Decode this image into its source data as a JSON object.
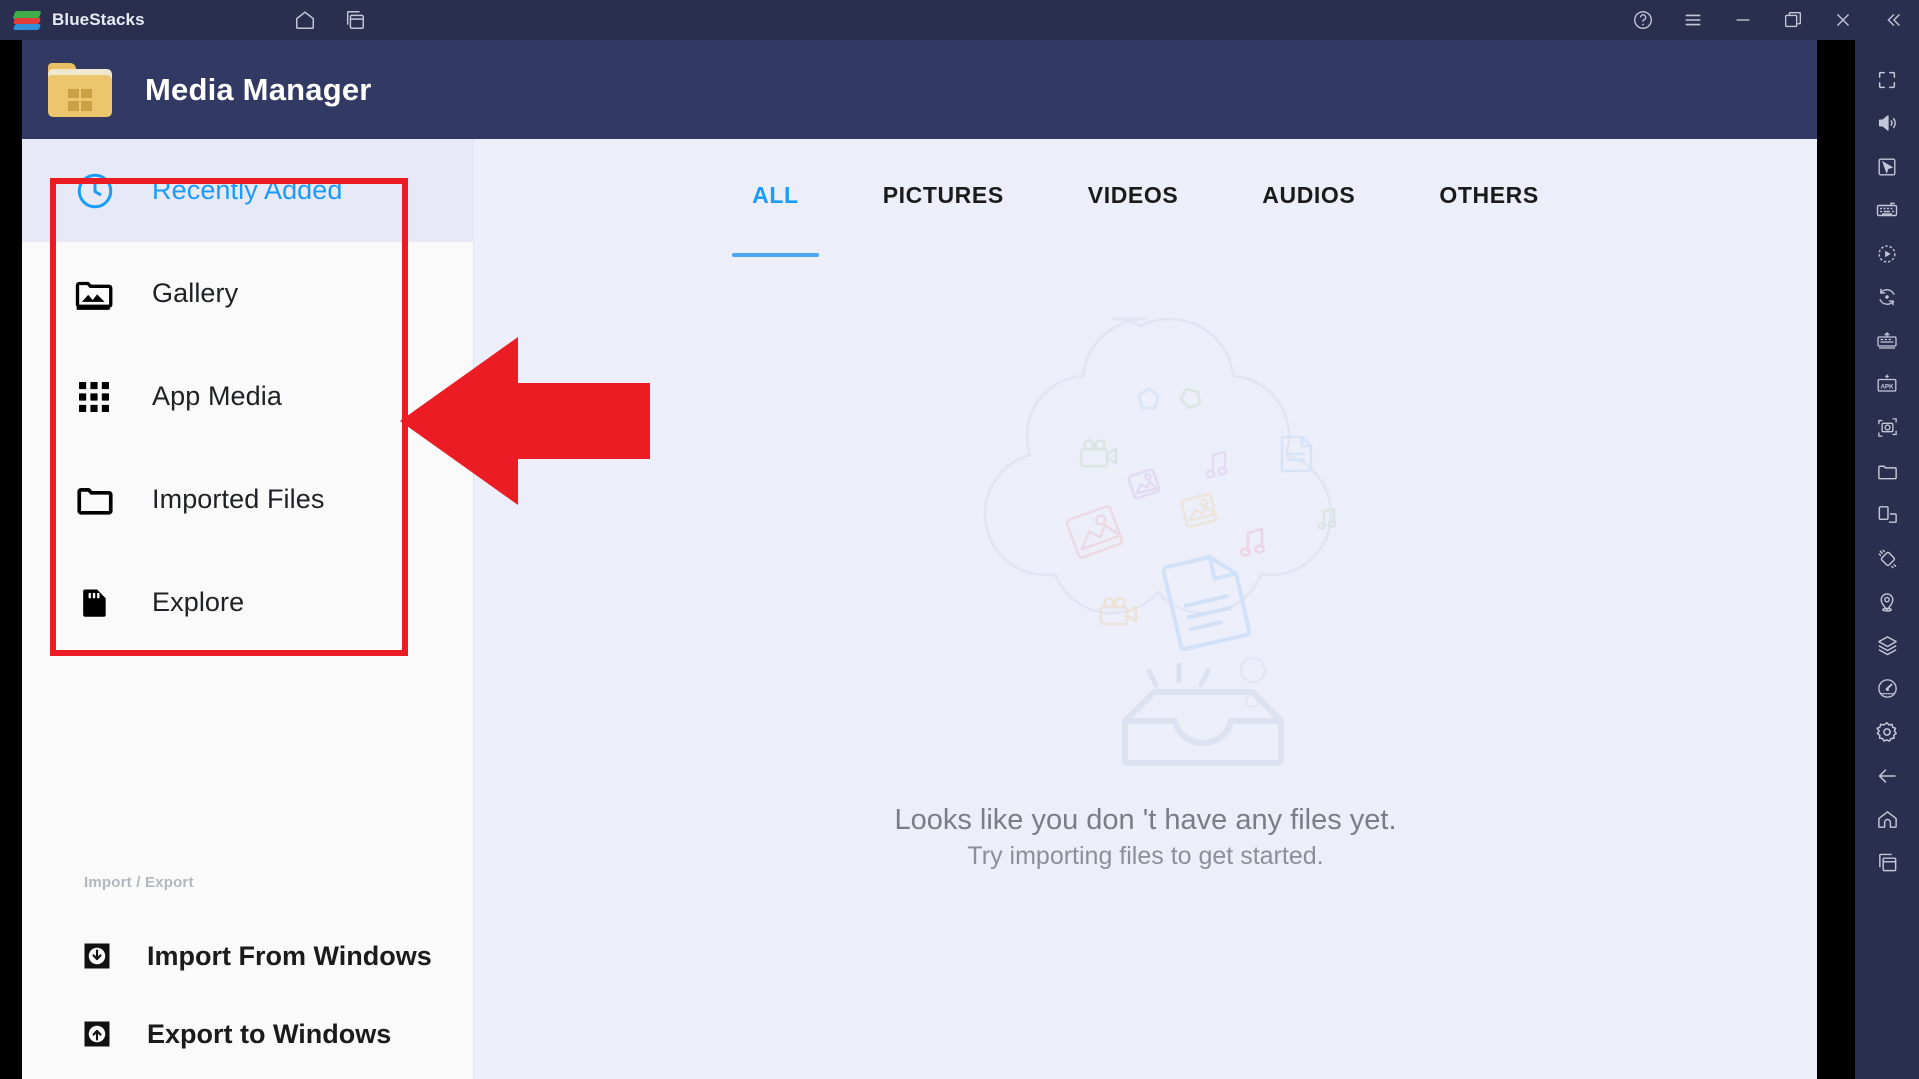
{
  "titlebar": {
    "app_name": "BlueStacks",
    "logo_name": "bluestacks-logo",
    "left_icons": [
      {
        "name": "home-icon",
        "label": "Home"
      },
      {
        "name": "multi-instance-icon",
        "label": "Multi-instance"
      }
    ],
    "right_icons": [
      {
        "name": "help-icon",
        "label": "Help"
      },
      {
        "name": "menu-icon",
        "label": "Menu"
      },
      {
        "name": "minimize-icon",
        "label": "Minimize"
      },
      {
        "name": "restore-icon",
        "label": "Restore"
      },
      {
        "name": "close-icon",
        "label": "Close"
      },
      {
        "name": "collapse-icon",
        "label": "Collapse"
      }
    ]
  },
  "app_header": {
    "title": "Media Manager",
    "icon": "windows-folder-icon",
    "background": "#323a64"
  },
  "sidebar": {
    "items": [
      {
        "label": "Recently Added",
        "icon": "clock-icon",
        "active": true
      },
      {
        "label": "Gallery",
        "icon": "photo-library-icon",
        "active": false
      },
      {
        "label": "App Media",
        "icon": "grid-apps-icon",
        "active": false
      },
      {
        "label": "Imported Files",
        "icon": "folder-icon",
        "active": false
      },
      {
        "label": "Explore",
        "icon": "sd-card-icon",
        "active": false
      }
    ],
    "import_export": {
      "heading": "Import / Export",
      "items": [
        {
          "label": "Import From Windows",
          "icon": "download-arrow-icon"
        },
        {
          "label": "Export to Windows",
          "icon": "upload-arrow-icon"
        }
      ]
    }
  },
  "main": {
    "tabs": [
      {
        "label": "ALL",
        "active": true
      },
      {
        "label": "PICTURES",
        "active": false
      },
      {
        "label": "VIDEOS",
        "active": false
      },
      {
        "label": "AUDIOS",
        "active": false
      },
      {
        "label": "OTHERS",
        "active": false
      }
    ],
    "empty_state": {
      "illustration": "cloud-with-media-files-over-inbox-tray-illustration",
      "line1": "Looks like you don 't have any files yet.",
      "line2": "Try importing files to get started."
    }
  },
  "right_toolbar": {
    "icons": [
      {
        "name": "fullscreen-icon",
        "label": "Fullscreen"
      },
      {
        "name": "volume-icon",
        "label": "Volume"
      },
      {
        "name": "cursor-pointer-icon",
        "label": "Game controls"
      },
      {
        "name": "keyboard-icon",
        "label": "Keyboard controls"
      },
      {
        "name": "macro-record-icon",
        "label": "Macro recorder"
      },
      {
        "name": "rotate-icon",
        "label": "Rotate"
      },
      {
        "name": "multi-instance-sync-icon",
        "label": "Sync operations"
      },
      {
        "name": "apk-install-icon",
        "label": "Install APK"
      },
      {
        "name": "screenshot-icon",
        "label": "Screenshot"
      },
      {
        "name": "media-folder-icon",
        "label": "Media manager"
      },
      {
        "name": "resize-window-icon",
        "label": "Resize window"
      },
      {
        "name": "shake-icon",
        "label": "Shake"
      },
      {
        "name": "location-icon",
        "label": "Location"
      },
      {
        "name": "layers-icon",
        "label": "Eco mode"
      },
      {
        "name": "performance-gauge-icon",
        "label": "Performance"
      },
      {
        "name": "gear-icon",
        "label": "Settings"
      },
      {
        "name": "back-arrow-icon",
        "label": "Back"
      },
      {
        "name": "home-icon",
        "label": "Home"
      },
      {
        "name": "recents-icon",
        "label": "Recents"
      }
    ]
  },
  "annotations": {
    "highlight_box_color": "#ec1c24",
    "arrow_color": "#ec1c24",
    "arrow_direction": "left",
    "highlight_target": "sidebar-navigation-list"
  }
}
